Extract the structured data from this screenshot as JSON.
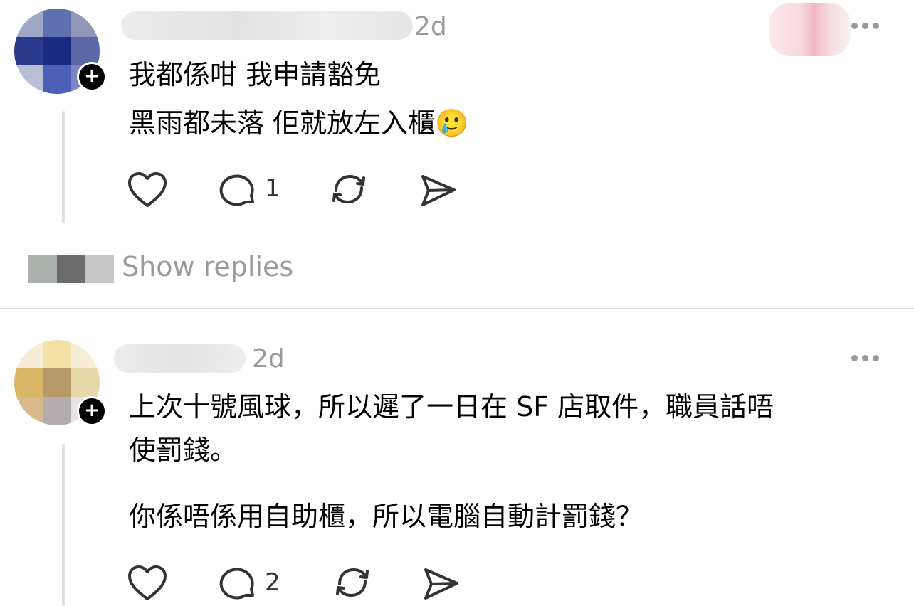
{
  "posts": [
    {
      "timestamp": "2d",
      "lines": [
        "我都係咁 我申請豁免",
        "黑雨都未落 佢就放左入櫃"
      ],
      "emoji": "🥲",
      "like_icon": "heart-icon",
      "reply_icon": "comment-icon",
      "reply_count": "1",
      "repost_icon": "repost-icon",
      "share_icon": "send-icon"
    },
    {
      "timestamp": "2d",
      "lines": [
        "上次十號風球，所以遲了一日在 SF 店取件，職員話唔",
        "使罰錢。",
        "你係唔係用自助櫃，所以電腦自動計罰錢？"
      ],
      "like_icon": "heart-icon",
      "reply_icon": "comment-icon",
      "reply_count": "2",
      "repost_icon": "repost-icon",
      "share_icon": "send-icon"
    }
  ],
  "show_replies_label": "Show replies",
  "colors": {
    "muted": "#9a9a9a",
    "thread_line": "#e1e1e1",
    "icon": "#333333"
  }
}
